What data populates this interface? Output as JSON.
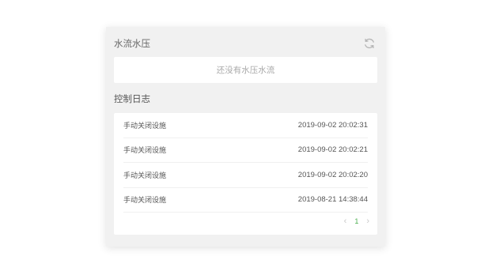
{
  "water_panel": {
    "title": "水流水压",
    "refresh_icon": "refresh-icon",
    "empty_text": "还没有水压水流"
  },
  "log_panel": {
    "title": "控制日志",
    "rows": [
      {
        "action": "手动关闭设施",
        "time": "2019-09-02 20:02:31"
      },
      {
        "action": "手动关闭设施",
        "time": "2019-09-02 20:02:21"
      },
      {
        "action": "手动关闭设施",
        "time": "2019-09-02 20:02:20"
      },
      {
        "action": "手动关闭设施",
        "time": "2019-08-21 14:38:44"
      }
    ],
    "pagination": {
      "prev": "‹",
      "current_page": "1",
      "next": "›"
    }
  },
  "colors": {
    "panel_bg": "#f1f1f1",
    "accent_green": "#4caf50"
  }
}
